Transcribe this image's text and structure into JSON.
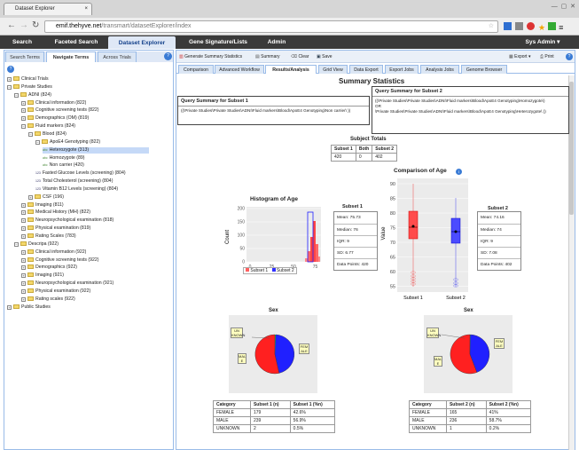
{
  "browser": {
    "tab_title": "Dataset Explorer",
    "url_host": "emif.thehyve.net",
    "url_path": "/transmart/datasetExplorer/index"
  },
  "nav": {
    "items": [
      "Search",
      "Faceted Search",
      "Dataset Explorer",
      "Gene Signature/Lists",
      "Admin"
    ],
    "user": "Sys Admin ▾"
  },
  "left": {
    "tabs": [
      "Search Terms",
      "Navigate Terms",
      "Across Trials"
    ],
    "tree": [
      {
        "d": 0,
        "pm": "+",
        "t": "Clinical Trials"
      },
      {
        "d": 0,
        "pm": "-",
        "t": "Private Studies"
      },
      {
        "d": 1,
        "pm": "-",
        "t": "ADNI (824)"
      },
      {
        "d": 2,
        "pm": "+",
        "t": "Clinical information (822)"
      },
      {
        "d": 2,
        "pm": "+",
        "t": "Cognitive screening tests (822)"
      },
      {
        "d": 2,
        "pm": "+",
        "t": "Demographics (OM) (819)"
      },
      {
        "d": 2,
        "pm": "-",
        "t": "Fluid markers (824)"
      },
      {
        "d": 3,
        "pm": "-",
        "t": "Blood (824)"
      },
      {
        "d": 4,
        "pm": "-",
        "t": "ApoE4 Genotyping (822)"
      },
      {
        "d": 5,
        "pm": "",
        "t": "Heterozygote (313)",
        "leaf": true,
        "sel": true
      },
      {
        "d": 5,
        "pm": "",
        "t": "Homozygote (89)",
        "leaf": true
      },
      {
        "d": 5,
        "pm": "",
        "t": "Non carrier (420)",
        "leaf": true
      },
      {
        "d": 4,
        "pm": "",
        "t": "Fasted Glucose Levels (screening) (804)",
        "num": true
      },
      {
        "d": 4,
        "pm": "",
        "t": "Total Cholesterol (screening) (804)",
        "num": true
      },
      {
        "d": 4,
        "pm": "",
        "t": "Vitamin B12 Levels (screening) (804)",
        "num": true
      },
      {
        "d": 3,
        "pm": "+",
        "t": "CSF (196)"
      },
      {
        "d": 2,
        "pm": "+",
        "t": "Imaging (811)"
      },
      {
        "d": 2,
        "pm": "+",
        "t": "Medical History (MH) (822)"
      },
      {
        "d": 2,
        "pm": "+",
        "t": "Neuropsychological examination (818)"
      },
      {
        "d": 2,
        "pm": "+",
        "t": "Physical examination (819)"
      },
      {
        "d": 2,
        "pm": "+",
        "t": "Rating Scales (783)"
      },
      {
        "d": 1,
        "pm": "-",
        "t": "Descripa (922)"
      },
      {
        "d": 2,
        "pm": "+",
        "t": "Clinical information (922)"
      },
      {
        "d": 2,
        "pm": "+",
        "t": "Cognitive screening tests (922)"
      },
      {
        "d": 2,
        "pm": "+",
        "t": "Demographics (922)"
      },
      {
        "d": 2,
        "pm": "+",
        "t": "Imaging (921)"
      },
      {
        "d": 2,
        "pm": "+",
        "t": "Neuropsychological examination (921)"
      },
      {
        "d": 2,
        "pm": "+",
        "t": "Physical examination (922)"
      },
      {
        "d": 2,
        "pm": "+",
        "t": "Rating scales (922)"
      },
      {
        "d": 0,
        "pm": "+",
        "t": "Public Studies"
      }
    ]
  },
  "toolbar": {
    "gen": "Generate Summary Statistics",
    "summary": "Summary",
    "clear": "Clear",
    "save": "Save",
    "export": "Export ▾",
    "print": "Print"
  },
  "subtabs": [
    "Comparison",
    "Advanced Workflow",
    "Results/Analysis",
    "Grid View",
    "Data Export",
    "Export Jobs",
    "Analysis Jobs",
    "Genome Browser"
  ],
  "summary": {
    "title": "Summary Statistics",
    "q1_title": "Query Summary for Subset 1",
    "q1_body": "((\\Private Studies\\Private Studies\\ADNI\\Fluid markers\\Blood\\ApoE4 Genotyping\\Non carrier\\ ))",
    "q2_title": "Query Summary for Subset 2",
    "q2_body1": "((\\Private Studies\\Private Studies\\ADNI\\Fluid markers\\Blood\\ApoE4 Genotyping\\Homozygote\\)",
    "q2_or": "OR",
    "q2_body2": "\\Private Studies\\Private Studies\\ADNI\\Fluid markers\\Blood\\ApoE4 Genotyping\\Heterozygote\\ ))",
    "totals_title": "Subject Totals",
    "totals_head": [
      "Subset 1",
      "Both",
      "Subset 2"
    ],
    "totals_vals": [
      "420",
      "0",
      "402"
    ],
    "hist_title": "Histogram of Age",
    "hist_ylabel": "Count",
    "hist_xticks": [
      "0",
      "25",
      "50",
      "75"
    ],
    "hist_yticks": [
      "0",
      "50",
      "100",
      "150",
      "200"
    ],
    "legend1": "Subset 1",
    "legend2": "Subset 2",
    "s1_title": "Subset 1",
    "s1": [
      "Mean: 75.73",
      "Median: 76",
      "IQR: 9",
      "SD: 6.77",
      "Data Points: 420"
    ],
    "box_title": "Comparison of Age",
    "box_ylabel": "Value",
    "box_yticks": [
      "90",
      "85",
      "80",
      "75",
      "70",
      "65",
      "60",
      "55"
    ],
    "box_xlabels": [
      "Subset 1",
      "Subset 2"
    ],
    "s2_title": "Subset 2",
    "s2": [
      "Mean: 74.16",
      "Median: 74",
      "IQR: 9",
      "SD: 7.08",
      "Data Points: 402"
    ],
    "sex_title": "Sex",
    "pie1_labels": [
      "UN KNOWN",
      "FEM ALE",
      "MAL E"
    ],
    "pie2_labels": [
      "UN KNOWN",
      "FEM ALE",
      "MAL E"
    ],
    "t1_head": [
      "Category",
      "Subset 1 (n)",
      "Subset 1 (%n)"
    ],
    "t1_rows": [
      [
        "FEMALE",
        "179",
        "42.6%"
      ],
      [
        "MALE",
        "239",
        "56.9%"
      ],
      [
        "UNKNOWN",
        "2",
        "0.5%"
      ]
    ],
    "t2_head": [
      "Category",
      "Subset 2 (n)",
      "Subset 2 (%n)"
    ],
    "t2_rows": [
      [
        "FEMALE",
        "165",
        "41%"
      ],
      [
        "MALE",
        "236",
        "58.7%"
      ],
      [
        "UNKNOWN",
        "1",
        "0.2%"
      ]
    ]
  },
  "colors": {
    "subset1": "#ff2020",
    "subset2": "#2020ff",
    "nav": "#3a3a3a"
  }
}
